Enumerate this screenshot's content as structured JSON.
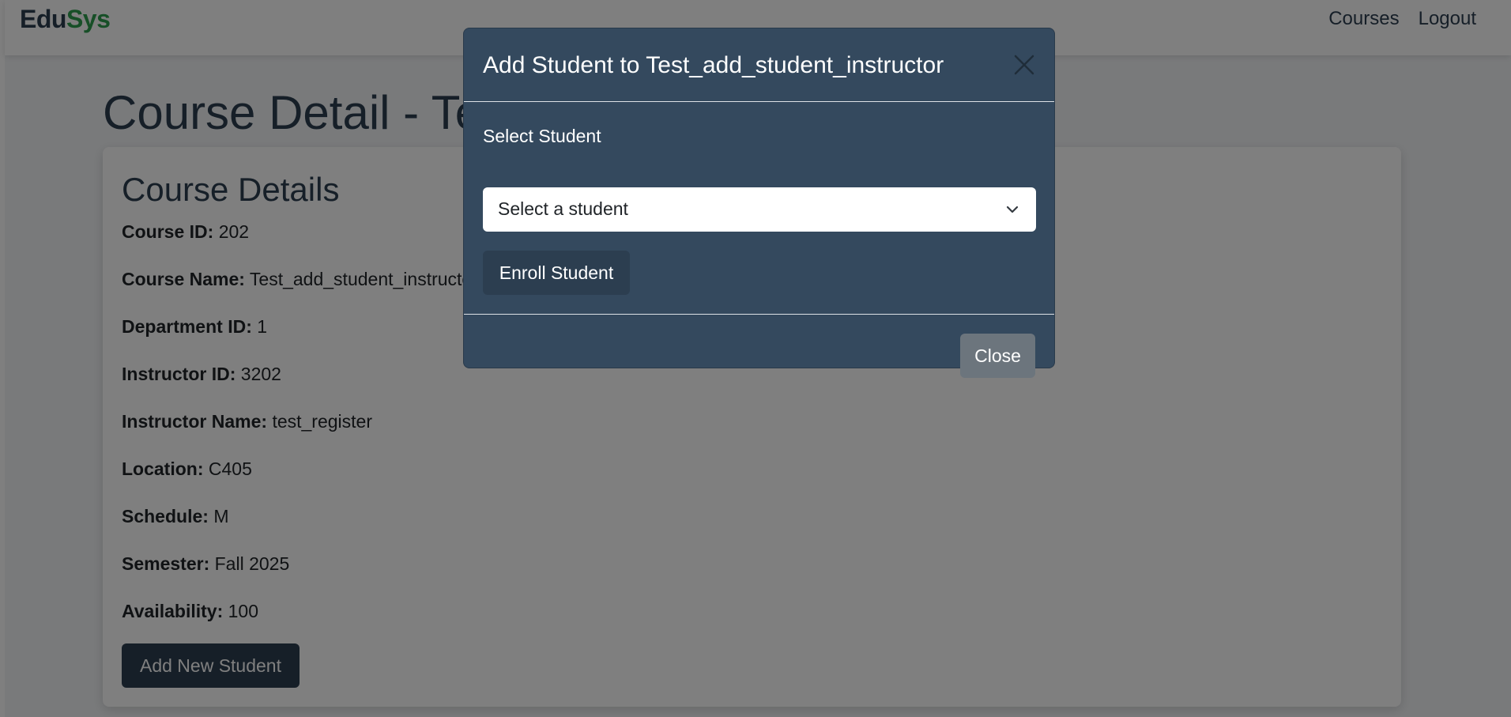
{
  "navbar": {
    "brand_part1": "Edu",
    "brand_part2": "Sys",
    "links": [
      "Courses",
      "Logout"
    ]
  },
  "page": {
    "title": "Course Detail - Test_add_student_instructor"
  },
  "card": {
    "title": "Course Details",
    "fields": [
      {
        "label": "Course ID:",
        "value": "202"
      },
      {
        "label": "Course Name:",
        "value": "Test_add_student_instructor"
      },
      {
        "label": "Department ID:",
        "value": "1"
      },
      {
        "label": "Instructor ID:",
        "value": "3202"
      },
      {
        "label": "Instructor Name:",
        "value": "test_register"
      },
      {
        "label": "Location:",
        "value": "C405"
      },
      {
        "label": "Schedule:",
        "value": "M"
      },
      {
        "label": "Semester:",
        "value": "Fall 2025"
      },
      {
        "label": "Availability:",
        "value": "100"
      }
    ],
    "add_button": "Add New Student"
  },
  "modal": {
    "title": "Add Student to Test_add_student_instructor",
    "select_label": "Select Student",
    "select_value": "Select a student",
    "enroll_button": "Enroll Student",
    "close_button": "Close"
  },
  "colors": {
    "primary": "#2c3e50",
    "brand_accent": "#2e9e4f",
    "modal_bg": "#34495e",
    "secondary_button": "#6c757d"
  }
}
